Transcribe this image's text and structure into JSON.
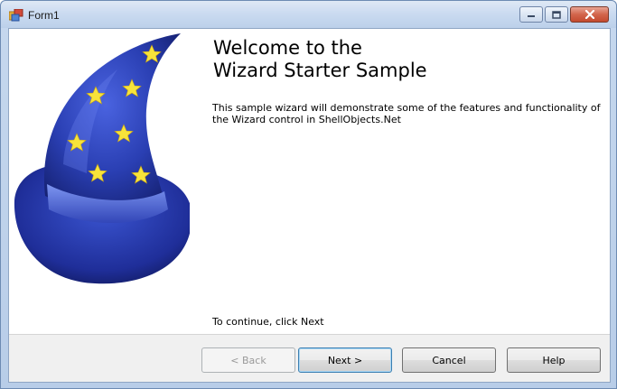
{
  "window": {
    "title": "Form1",
    "icon": "form-app-icon",
    "caption_buttons": [
      "minimize-icon",
      "maximize-icon",
      "close-icon"
    ]
  },
  "wizard": {
    "title_line1": "Welcome to the",
    "title_line2": "Wizard Starter Sample",
    "description": "This sample wizard will demonstrate some of the features and functionality of the Wizard control in ShellObjects.Net",
    "continue_text": "To continue, click Next",
    "image": "wizard-hat-icon"
  },
  "buttons": {
    "back": "< Back",
    "next": "Next >",
    "cancel": "Cancel",
    "help": "Help"
  },
  "colors": {
    "hat_primary": "#2a3fb3",
    "star": "#f7e33a",
    "titlebar": "#c9daf0",
    "close_button": "#c9553a"
  }
}
